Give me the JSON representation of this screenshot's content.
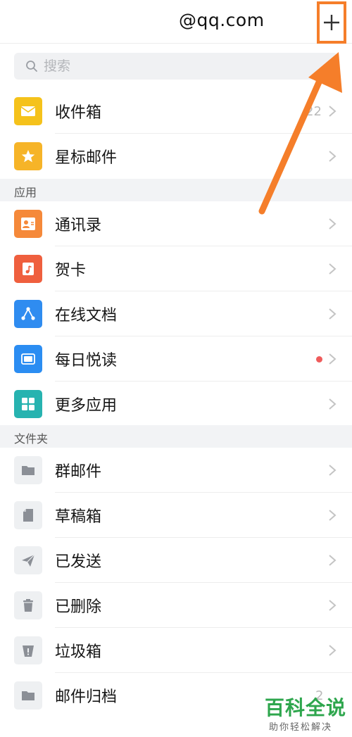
{
  "header": {
    "title": "@qq.com",
    "add_icon": "plus-icon"
  },
  "search": {
    "placeholder": "搜索",
    "value": ""
  },
  "mailboxes": [
    {
      "label": "收件箱",
      "icon": "envelope-icon",
      "color": "#f5c21b",
      "badge": "22"
    },
    {
      "label": "星标邮件",
      "icon": "star-icon",
      "color": "#f6b428",
      "badge": ""
    }
  ],
  "sections": {
    "apps": "应用",
    "folders": "文件夹"
  },
  "apps": [
    {
      "label": "通讯录",
      "icon": "contact-card-icon",
      "color": "#f5893a"
    },
    {
      "label": "贺卡",
      "icon": "greeting-card-icon",
      "color": "#ef5f3e"
    },
    {
      "label": "在线文档",
      "icon": "share-nodes-icon",
      "color": "#2f8cf0"
    },
    {
      "label": "每日悦读",
      "icon": "reader-icon",
      "color": "#2b8df2",
      "dot": true
    },
    {
      "label": "更多应用",
      "icon": "grid-icon",
      "color": "#27b3b0"
    }
  ],
  "folders": [
    {
      "label": "群邮件",
      "icon": "folder-icon"
    },
    {
      "label": "草稿箱",
      "icon": "draft-page-icon"
    },
    {
      "label": "已发送",
      "icon": "paper-plane-icon"
    },
    {
      "label": "已删除",
      "icon": "trash-icon"
    },
    {
      "label": "垃圾箱",
      "icon": "junk-bin-icon"
    },
    {
      "label": "邮件归档",
      "icon": "archive-folder-icon",
      "badge": "2"
    }
  ],
  "colors": {
    "folder_icon_bg": "#eef0f2",
    "folder_icon_fg": "#8b8f96",
    "highlight": "#f57e2a"
  },
  "watermark": {
    "main": "百科全说",
    "sub": "助你轻松解决"
  }
}
